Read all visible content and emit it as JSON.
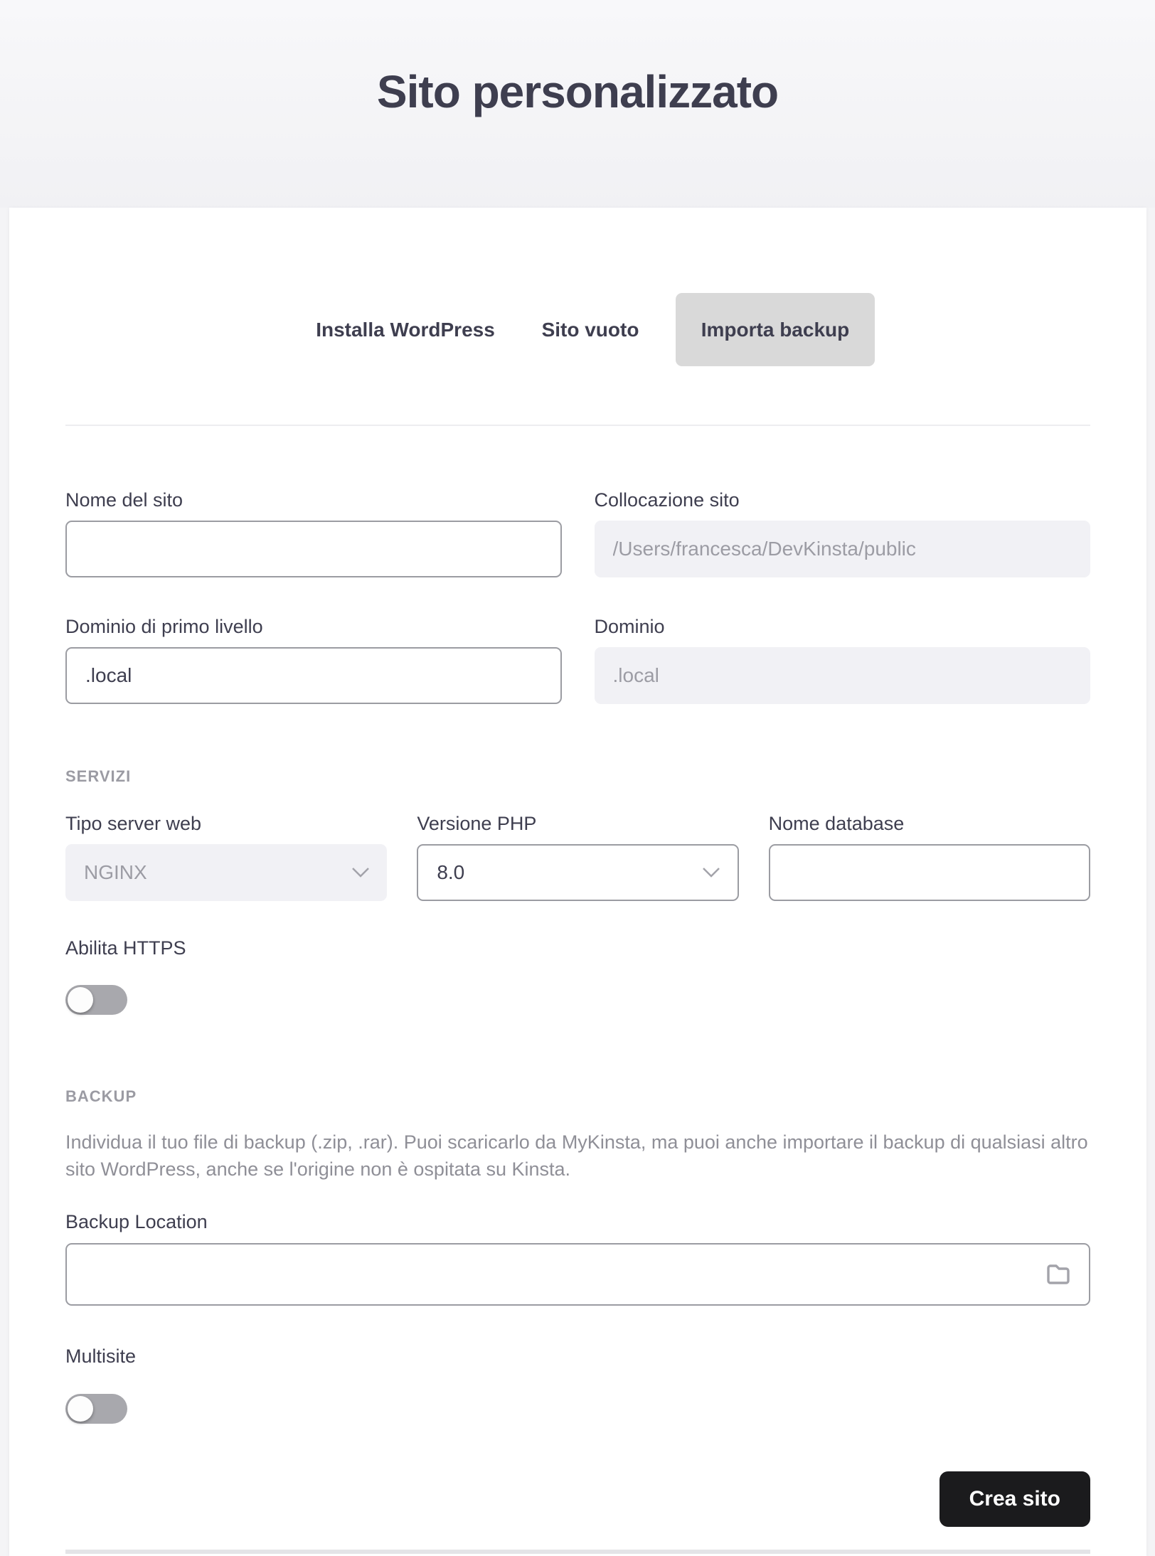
{
  "page": {
    "title": "Sito personalizzato"
  },
  "tabs": [
    {
      "label": "Installa WordPress",
      "selected": false
    },
    {
      "label": "Sito vuoto",
      "selected": false
    },
    {
      "label": "Importa backup",
      "selected": true
    }
  ],
  "form": {
    "site_name": {
      "label": "Nome del sito",
      "value": ""
    },
    "site_location": {
      "label": "Collocazione sito",
      "value": "/Users/francesca/DevKinsta/public",
      "disabled": true
    },
    "tld": {
      "label": "Dominio di primo livello",
      "value": ".local"
    },
    "domain": {
      "label": "Dominio",
      "value": ".local",
      "disabled": true
    },
    "services": {
      "section_label": "SERVIZI",
      "web_server": {
        "label": "Tipo server web",
        "value": "NGINX",
        "disabled": true
      },
      "php_version": {
        "label": "Versione PHP",
        "value": "8.0"
      },
      "database_name": {
        "label": "Nome database",
        "value": ""
      }
    },
    "https": {
      "label": "Abilita HTTPS",
      "enabled": false
    },
    "backup": {
      "section_label": "BACKUP",
      "description": "Individua il tuo file di backup (.zip, .rar). Puoi scaricarlo da MyKinsta, ma puoi anche importare il backup di qualsiasi altro sito WordPress, anche se l'origine non è ospitata su Kinsta.",
      "location": {
        "label": "Backup Location",
        "value": ""
      }
    },
    "multisite": {
      "label": "Multisite",
      "enabled": false
    }
  },
  "actions": {
    "create_label": "Crea sito"
  },
  "colors": {
    "accent_button": "#1b1b1d",
    "selected_tab": "#d9d9d9",
    "disabled_field_bg": "#f1f1f5",
    "toggle_track_off": "#a8a8ad",
    "text_primary": "#3e3e4f",
    "text_muted": "#8f8f97"
  }
}
